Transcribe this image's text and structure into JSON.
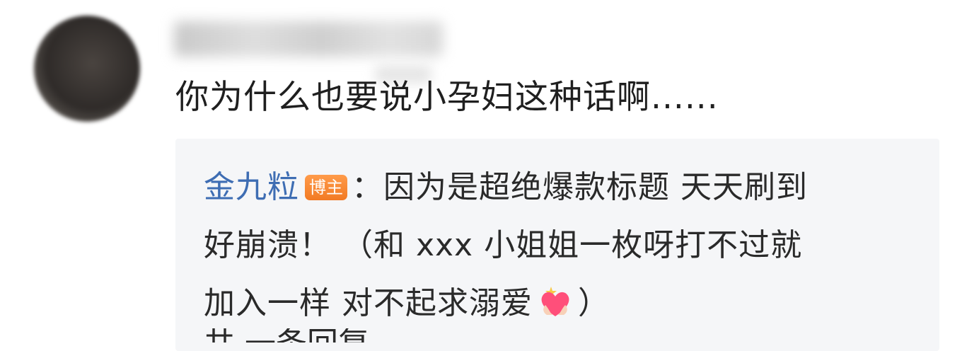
{
  "comment": {
    "text": "你为什么也要说小孕妇这种话啊......"
  },
  "reply": {
    "author": "金九粒",
    "badge": "博主",
    "separator": "：",
    "text_line1": "因为是超绝爆款标题 天天刷到",
    "text_line2": "好崩溃！ （和 xxx 小姐姐一枚呀打不过就",
    "text_line3_before_emoji": "加入一样 对不起求溺爱",
    "text_line3_after_emoji": "）",
    "emoji": "heart-hands-emoji",
    "cutoff_text": "共 一条回复"
  },
  "colors": {
    "author_link": "#3e6db3",
    "badge_bg": "#f27a24",
    "reply_bg": "#f5f6f8",
    "text": "#1f1f1f",
    "heart": "#ff4f7a"
  }
}
